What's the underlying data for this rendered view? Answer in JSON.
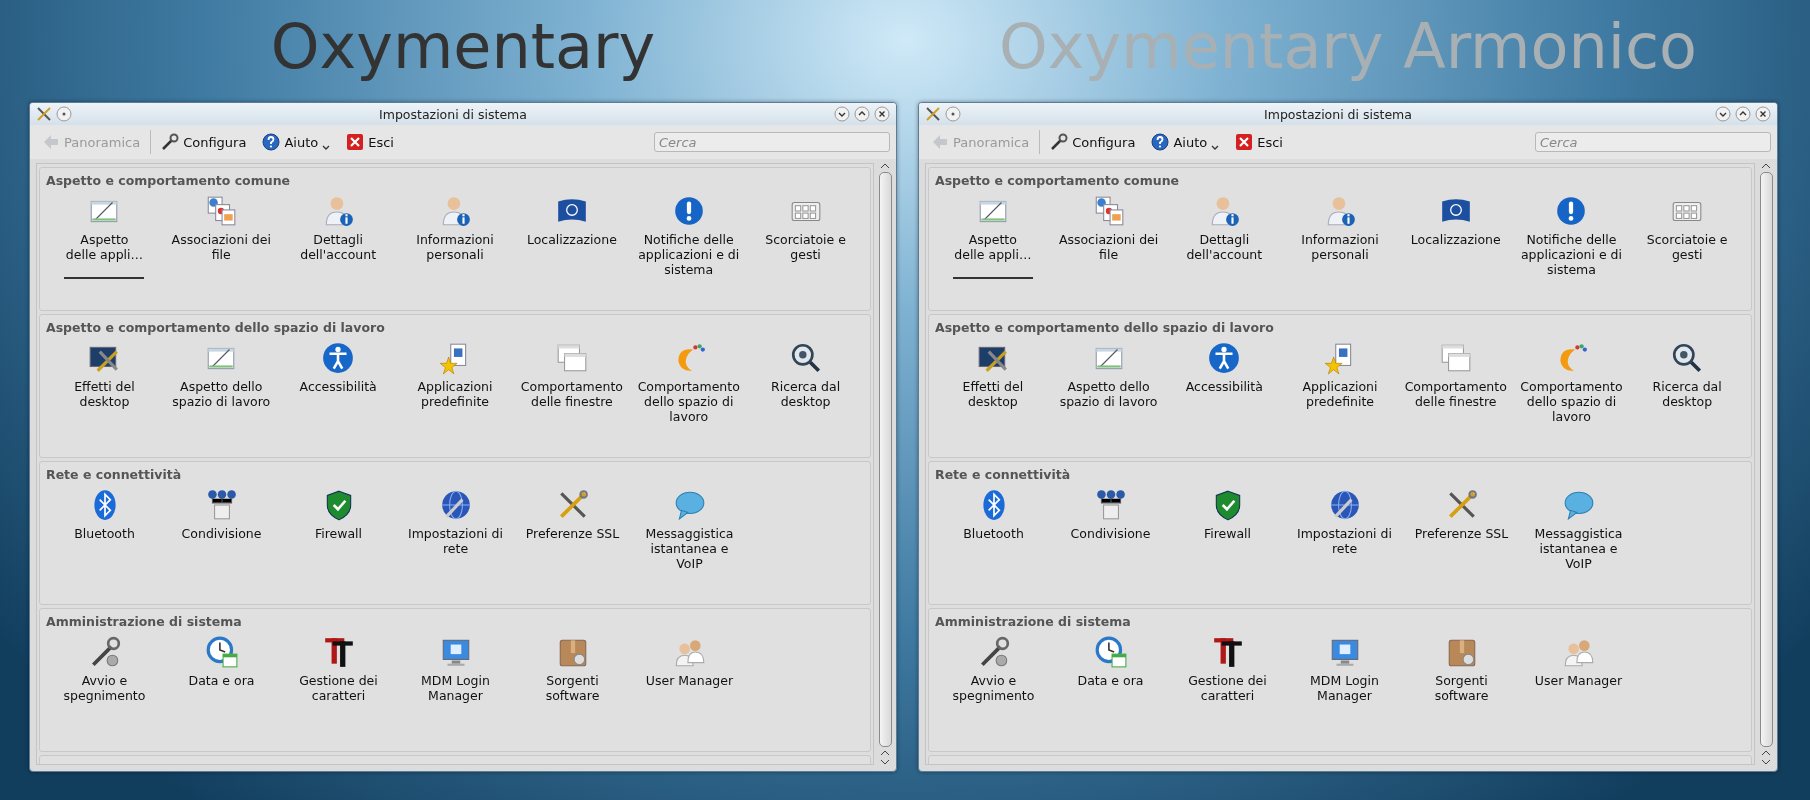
{
  "windows": [
    {
      "heading": {
        "text": "Oxymentary",
        "color": "#333333"
      },
      "title": "Impostazioni di sistema",
      "toolbar": {
        "back": {
          "label": "Panoramica",
          "disabled": true
        },
        "buttons": [
          "Configura",
          "Aiuto",
          "Esci"
        ]
      },
      "search": {
        "placeholder": "Cerca"
      },
      "sections": [
        {
          "title": "Aspetto e comportamento comune",
          "items": [
            {
              "label": "Aspetto delle appli…",
              "selected": true
            },
            {
              "label": "Associazioni dei file",
              "selected": false
            },
            {
              "label": "Dettagli dell'account",
              "selected": false
            },
            {
              "label": "Informazioni personali",
              "selected": false
            },
            {
              "label": "Localizzazione",
              "selected": false
            },
            {
              "label": "Notifiche delle applicazioni e di sistema",
              "selected": false
            },
            {
              "label": "Scorciatoie e gesti",
              "selected": false
            }
          ]
        },
        {
          "title": "Aspetto e comportamento dello spazio di lavoro",
          "items": [
            {
              "label": "Effetti del desktop",
              "selected": false
            },
            {
              "label": "Aspetto dello spazio di lavoro",
              "selected": false
            },
            {
              "label": "Accessibilità",
              "selected": false
            },
            {
              "label": "Applicazioni predefinite",
              "selected": false
            },
            {
              "label": "Comportamento delle finestre",
              "selected": false
            },
            {
              "label": "Comportamento dello spazio di lavoro",
              "selected": false
            },
            {
              "label": "Ricerca dal desktop",
              "selected": false
            }
          ]
        },
        {
          "title": "Rete e connettività",
          "items": [
            {
              "label": "Bluetooth",
              "selected": false
            },
            {
              "label": "Condivisione",
              "selected": false
            },
            {
              "label": "Firewall",
              "selected": false
            },
            {
              "label": "Impostazioni di rete",
              "selected": false
            },
            {
              "label": "Preferenze SSL",
              "selected": false
            },
            {
              "label": "Messaggistica istantanea e VoIP",
              "selected": false
            }
          ]
        },
        {
          "title": "Amministrazione di sistema",
          "items": [
            {
              "label": "Avvio e spegnimento",
              "selected": false
            },
            {
              "label": "Data e ora",
              "selected": false
            },
            {
              "label": "Gestione dei caratteri",
              "selected": false
            },
            {
              "label": "MDM Login Manager",
              "selected": false
            },
            {
              "label": "Sorgenti software",
              "selected": false
            },
            {
              "label": "User Manager",
              "selected": false
            }
          ]
        }
      ]
    },
    {
      "heading": {
        "text": "Oxymentary Armonico",
        "color": "#a9b0b3"
      },
      "title": "Impostazioni di sistema",
      "toolbar": {
        "back": {
          "label": "Panoramica",
          "disabled": true
        },
        "buttons": [
          "Configura",
          "Aiuto",
          "Esci"
        ]
      },
      "search": {
        "placeholder": "Cerca"
      },
      "sections": [
        {
          "title": "Aspetto e comportamento comune",
          "items": [
            {
              "label": "Aspetto delle appli…",
              "selected": true
            },
            {
              "label": "Associazioni dei file",
              "selected": false
            },
            {
              "label": "Dettagli dell'account",
              "selected": false
            },
            {
              "label": "Informazioni personali",
              "selected": false
            },
            {
              "label": "Localizzazione",
              "selected": false
            },
            {
              "label": "Notifiche delle applicazioni e di sistema",
              "selected": false
            },
            {
              "label": "Scorciatoie e gesti",
              "selected": false
            }
          ]
        },
        {
          "title": "Aspetto e comportamento dello spazio di lavoro",
          "items": [
            {
              "label": "Effetti del desktop",
              "selected": false
            },
            {
              "label": "Aspetto dello spazio di lavoro",
              "selected": false
            },
            {
              "label": "Accessibilità",
              "selected": false
            },
            {
              "label": "Applicazioni predefinite",
              "selected": false
            },
            {
              "label": "Comportamento delle finestre",
              "selected": false
            },
            {
              "label": "Comportamento dello spazio di lavoro",
              "selected": false
            },
            {
              "label": "Ricerca dal desktop",
              "selected": false
            }
          ]
        },
        {
          "title": "Rete e connettività",
          "items": [
            {
              "label": "Bluetooth",
              "selected": false
            },
            {
              "label": "Condivisione",
              "selected": false
            },
            {
              "label": "Firewall",
              "selected": false
            },
            {
              "label": "Impostazioni di rete",
              "selected": false
            },
            {
              "label": "Preferenze SSL",
              "selected": false
            },
            {
              "label": "Messaggistica istantanea e VoIP",
              "selected": false
            }
          ]
        },
        {
          "title": "Amministrazione di sistema",
          "items": [
            {
              "label": "Avvio e spegnimento",
              "selected": false
            },
            {
              "label": "Data e ora",
              "selected": false
            },
            {
              "label": "Gestione dei caratteri",
              "selected": false
            },
            {
              "label": "MDM Login Manager",
              "selected": false
            },
            {
              "label": "Sorgenti software",
              "selected": false
            },
            {
              "label": "User Manager",
              "selected": false
            }
          ]
        }
      ]
    }
  ]
}
